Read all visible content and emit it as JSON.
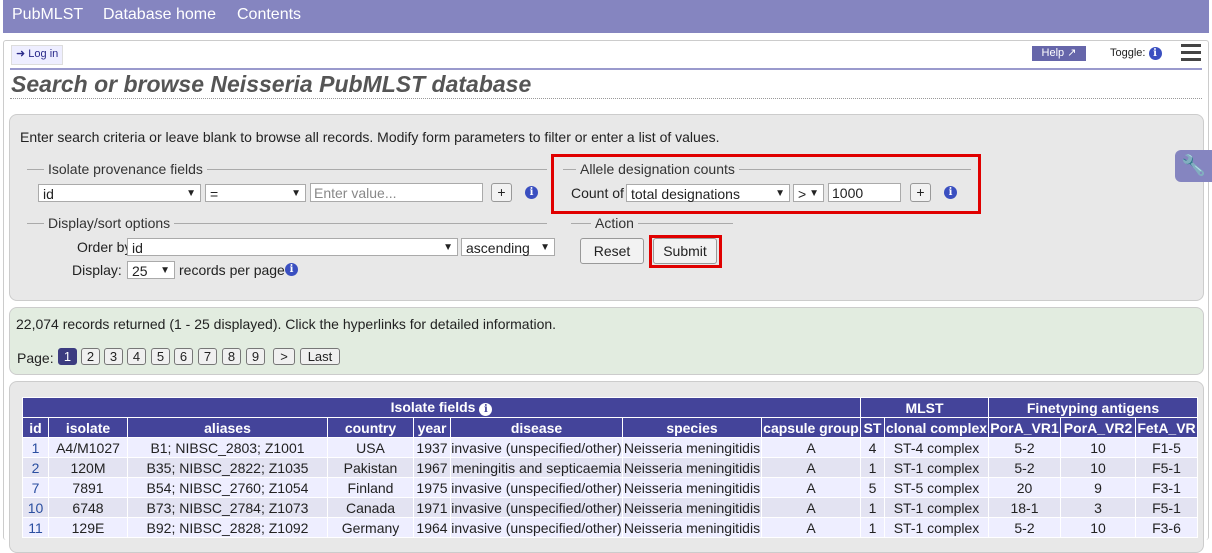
{
  "topnav": [
    "PubMLST",
    "Database home",
    "Contents"
  ],
  "login": "Log in",
  "help": "Help",
  "toggle": "Toggle:",
  "title": "Search or browse Neisseria PubMLST database",
  "intro": "Enter search criteria or leave blank to browse all records. Modify form parameters to filter or enter a list of values.",
  "provenance": {
    "legend": "Isolate provenance fields",
    "field": "id",
    "operator": "=",
    "placeholder": "Enter value..."
  },
  "allele": {
    "legend": "Allele designation counts",
    "count_label": "Count of",
    "type": "total designations",
    "operator": ">",
    "value": "1000"
  },
  "display": {
    "legend": "Display/sort options",
    "order_label": "Order by:",
    "order_field": "id",
    "order_dir": "ascending",
    "display_label": "Display:",
    "records": "25",
    "records_suffix": "records per page"
  },
  "action": {
    "legend": "Action",
    "reset": "Reset",
    "submit": "Submit"
  },
  "results_summary": "22,074 records returned (1 - 25 displayed). Click the hyperlinks for detailed information.",
  "pagination": {
    "label": "Page:",
    "pages": [
      "1",
      "2",
      "3",
      "4",
      "5",
      "6",
      "7",
      "8",
      "9"
    ],
    "next": ">",
    "last": "Last"
  },
  "table": {
    "groups": [
      "Isolate fields",
      "MLST",
      "Finetyping antigens"
    ],
    "columns": [
      "id",
      "isolate",
      "aliases",
      "country",
      "year",
      "disease",
      "species",
      "capsule group",
      "ST",
      "clonal complex",
      "PorA_VR1",
      "PorA_VR2",
      "FetA_VR"
    ],
    "rows": [
      [
        "1",
        "A4/M1027",
        "B1; NIBSC_2803; Z1001",
        "USA",
        "1937",
        "invasive (unspecified/other)",
        "Neisseria meningitidis",
        "A",
        "4",
        "ST-4 complex",
        "5-2",
        "10",
        "F1-5"
      ],
      [
        "2",
        "120M",
        "B35; NIBSC_2822; Z1035",
        "Pakistan",
        "1967",
        "meningitis and septicaemia",
        "Neisseria meningitidis",
        "A",
        "1",
        "ST-1 complex",
        "5-2",
        "10",
        "F5-1"
      ],
      [
        "7",
        "7891",
        "B54; NIBSC_2760; Z1054",
        "Finland",
        "1975",
        "invasive (unspecified/other)",
        "Neisseria meningitidis",
        "A",
        "5",
        "ST-5 complex",
        "20",
        "9",
        "F3-1"
      ],
      [
        "10",
        "6748",
        "B73; NIBSC_2784; Z1073",
        "Canada",
        "1971",
        "invasive (unspecified/other)",
        "Neisseria meningitidis",
        "A",
        "1",
        "ST-1 complex",
        "18-1",
        "3",
        "F5-1"
      ],
      [
        "11",
        "129E",
        "B92; NIBSC_2828; Z1092",
        "Germany",
        "1964",
        "invasive (unspecified/other)",
        "Neisseria meningitidis",
        "A",
        "1",
        "ST-1 complex",
        "5-2",
        "10",
        "F3-6"
      ]
    ]
  }
}
